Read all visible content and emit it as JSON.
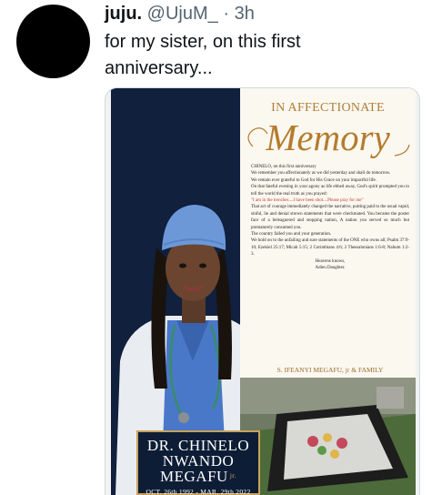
{
  "tweet": {
    "display_name": "juju.",
    "handle": "@UjuM_",
    "separator": "·",
    "time": "3h",
    "text_line1": "for my sister, on this first",
    "text_line2": "anniversary..."
  },
  "memorial": {
    "heading": "IN AFFECTIONATE",
    "script_title": "Memory",
    "paragraphs": [
      "CHINELO, on this first anniversary",
      "We remember you affectionately as we did yesterday and shall do tomorrow.",
      "We remain ever grateful to God for His Grace on your impactful life.",
      "On that fateful evening in your agony as life ebbed away, God's spirit prompted you to tell the world the real truth as you prayed:",
      "That act of courage immediately changed the narrative, putting paid to the usual vapid, sinful, lie and denial strewn statements that were checkmated. You became the poster face of a beleaguered and stopping nation, A nation you served so much but prematurely consumed you.",
      "The country failed you and your generation.",
      "We hold on to the unfailing and sure statements of the ONE who owns all; Psalm 37:9-10; Ezekiel 25:17; Micah 5:15; 2 Corinthians 4:6; 2 Thessalonians 1:6-8; Nahum 1:2-3.",
      "Heavens knows,",
      "Adieu Daughter."
    ],
    "quote": "\"I am in the trenches....I have been shot....Please pray for me\"",
    "signature": "S. IFEANYI MEGAFU, jr & FAMILY",
    "name_line1": "DR. CHINELO",
    "name_line2": "NWANDO",
    "name_line3": "MEGAFU",
    "name_suffix": "jr.",
    "dates": "OCT. 26th 1992 - MAR. 29th 2022"
  },
  "colors": {
    "gold": "#b47c2f",
    "navy": "#10203d",
    "scrub_blue": "#4a78c9",
    "quote_red": "#c0392b"
  }
}
